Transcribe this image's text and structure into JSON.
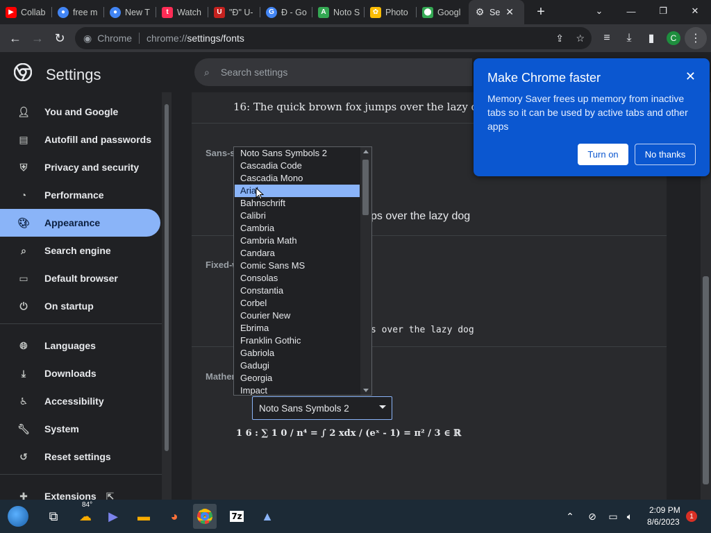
{
  "tabs": [
    {
      "label": "Collab",
      "icon": "youtube-icon",
      "color": "#ff0000"
    },
    {
      "label": "free m",
      "icon": "chrome-icon",
      "color": "#4285f4"
    },
    {
      "label": "New T",
      "icon": "chrome-icon",
      "color": "#4285f4"
    },
    {
      "label": "Watch",
      "icon": "tiktok-icon",
      "color": "#fe2c55"
    },
    {
      "label": "\"Ð\" U-",
      "icon": "unicode-site-icon",
      "color": "#c5221f"
    },
    {
      "label": "Ð - Go",
      "icon": "google-icon",
      "color": "#4285f4"
    },
    {
      "label": "Noto S",
      "icon": "google-fonts-icon",
      "color": "#34a853"
    },
    {
      "label": "Photo",
      "icon": "google-photos-icon",
      "color": "#fbbc04"
    },
    {
      "label": "Googl",
      "icon": "google-maps-icon",
      "color": "#34a853"
    },
    {
      "label": "Se",
      "icon": "gear-icon",
      "color": "#9aa0a6",
      "active": true
    }
  ],
  "omnibox": {
    "chip": "Chrome",
    "host": "chrome://",
    "path": "settings/fonts"
  },
  "profile_initial": "C",
  "header": {
    "title": "Settings",
    "search_placeholder": "Search settings"
  },
  "sidebar": {
    "items": [
      {
        "label": "You and Google",
        "icon": "person-icon"
      },
      {
        "label": "Autofill and passwords",
        "icon": "clipboard-icon"
      },
      {
        "label": "Privacy and security",
        "icon": "shield-icon"
      },
      {
        "label": "Performance",
        "icon": "speedometer-icon"
      },
      {
        "label": "Appearance",
        "icon": "palette-icon",
        "selected": true
      },
      {
        "label": "Search engine",
        "icon": "search-icon"
      },
      {
        "label": "Default browser",
        "icon": "browser-icon"
      },
      {
        "label": "On startup",
        "icon": "power-icon"
      },
      {
        "label": "Languages",
        "icon": "globe-icon"
      },
      {
        "label": "Downloads",
        "icon": "download-icon"
      },
      {
        "label": "Accessibility",
        "icon": "accessibility-icon"
      },
      {
        "label": "System",
        "icon": "wrench-icon"
      },
      {
        "label": "Reset settings",
        "icon": "reset-icon"
      },
      {
        "label": "Extensions",
        "icon": "puzzle-icon"
      }
    ]
  },
  "fonts": {
    "serif_sample": "16: The quick brown fox jumps over the lazy dog",
    "sans_label": "Sans-se",
    "sans_sample": "ps over the lazy dog",
    "fixed_label": "Fixed-w",
    "fixed_sample": "s over the lazy dog",
    "math_label": "Mathem",
    "math_select_value": "Noto Sans Symbols 2",
    "math_sample": "1 6 : ∑ 1 0 / n⁴ = ∫ 2 xdx / (eˣ - 1) = π² / 3 ∈ ℝ"
  },
  "dropdown": {
    "options": [
      "Noto Sans Symbols 2",
      "Cascadia Code",
      "Cascadia Mono",
      "Arial",
      "Bahnschrift",
      "Calibri",
      "Cambria",
      "Cambria Math",
      "Candara",
      "Comic Sans MS",
      "Consolas",
      "Constantia",
      "Corbel",
      "Courier New",
      "Ebrima",
      "Franklin Gothic",
      "Gabriola",
      "Gadugi",
      "Georgia",
      "Impact"
    ],
    "highlighted": "Arial"
  },
  "popup": {
    "title": "Make Chrome faster",
    "body": "Memory Saver frees up memory from inactive tabs so it can be used by active tabs and other apps",
    "primary": "Turn on",
    "secondary": "No thanks"
  },
  "taskbar": {
    "temp": "84°",
    "time": "2:09 PM",
    "date": "8/6/2023",
    "notifications": "1"
  },
  "colors": {
    "accent": "#8ab4f8",
    "popup_bg": "#0b57d0",
    "bg": "#202124",
    "card": "#292a2d"
  }
}
